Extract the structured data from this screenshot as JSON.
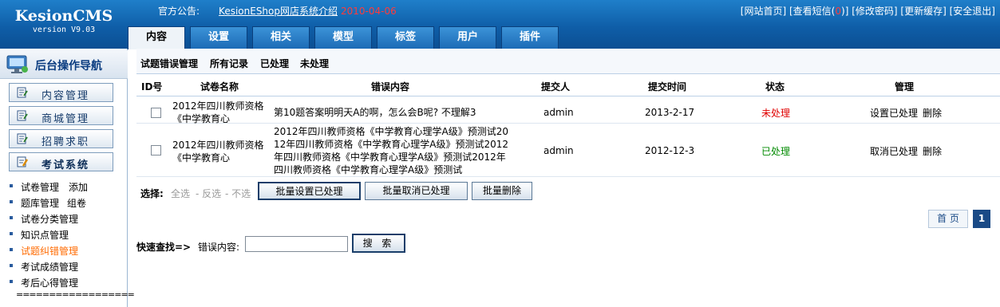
{
  "header": {
    "logo_title": "KesionCMS",
    "logo_version": "version V9.03",
    "notice_label": "官方公告:",
    "notice_link": "KesionEShop网店系统介绍",
    "notice_date": "2010-04-06",
    "links": {
      "home": "[网站首页]",
      "msg_prefix": "[查看短信(",
      "msg_count": "0",
      "msg_suffix": ")]",
      "pwd": "[修改密码]",
      "cache": "[更新缓存]",
      "logout": "[安全退出]"
    },
    "tabs": [
      "内容",
      "设置",
      "相关",
      "模型",
      "标签",
      "用户",
      "插件"
    ],
    "active_tab": "内容"
  },
  "sidebar": {
    "title": "后台操作导航",
    "menus": [
      "内容管理",
      "商城管理",
      "招聘求职",
      "考试系统"
    ],
    "subitems": [
      {
        "label": "试卷管理",
        "extra": "添加"
      },
      {
        "label": "题库管理",
        "extra": "组卷"
      },
      {
        "label": "试卷分类管理",
        "extra": ""
      },
      {
        "label": "知识点管理",
        "extra": ""
      },
      {
        "label": "试题纠错管理",
        "extra": ""
      },
      {
        "label": "考试成绩管理",
        "extra": ""
      },
      {
        "label": "考后心得管理",
        "extra": ""
      }
    ],
    "separator": "=================="
  },
  "main": {
    "crumbs": [
      "试题错误管理",
      "所有记录",
      "已处理",
      "未处理"
    ],
    "columns": [
      "ID号",
      "试卷名称",
      "错误内容",
      "提交人",
      "提交时间",
      "状态",
      "管理"
    ],
    "rows": [
      {
        "title_l1": "2012年四川教师资格",
        "title_l2": "《中学教育心",
        "error_lines": [
          "第10题答案明明天A的啊，怎么会B呢? 不理解3"
        ],
        "submitter": "admin",
        "time": "2013-2-17",
        "status": "未处理",
        "action": "设置已处理",
        "delete": "删除"
      },
      {
        "title_l1": "2012年四川教师资格",
        "title_l2": "《中学教育心",
        "error_lines": [
          "2012年四川教师资格《中学教育心理学A级》预测试20",
          "12年四川教师资格《中学教育心理学A级》预测试2012",
          "年四川教师资格《中学教育心理学A级》预测试2012年",
          "四川教师资格《中学教育心理学A级》预测试"
        ],
        "submitter": "admin",
        "time": "2012-12-3",
        "status": "已处理",
        "action": "取消已处理",
        "delete": "删除"
      }
    ],
    "batch": {
      "label": "选择:",
      "select_all": "全选",
      "invert": "- 反选",
      "none": "- 不选",
      "btn_set": "批量设置已处理",
      "btn_cancel": "批量取消已处理",
      "btn_delete": "批量删除"
    },
    "pager": {
      "first": "首 页",
      "current": "1"
    },
    "quick": {
      "label": "快速查找=>",
      "field_label": "错误内容:",
      "value": "",
      "button": "搜 索"
    }
  },
  "colors": {
    "brand_blue": "#0f5ea8",
    "status_pending": "#e00000",
    "status_done": "#008a00",
    "active_sub": "#ff6a00"
  }
}
